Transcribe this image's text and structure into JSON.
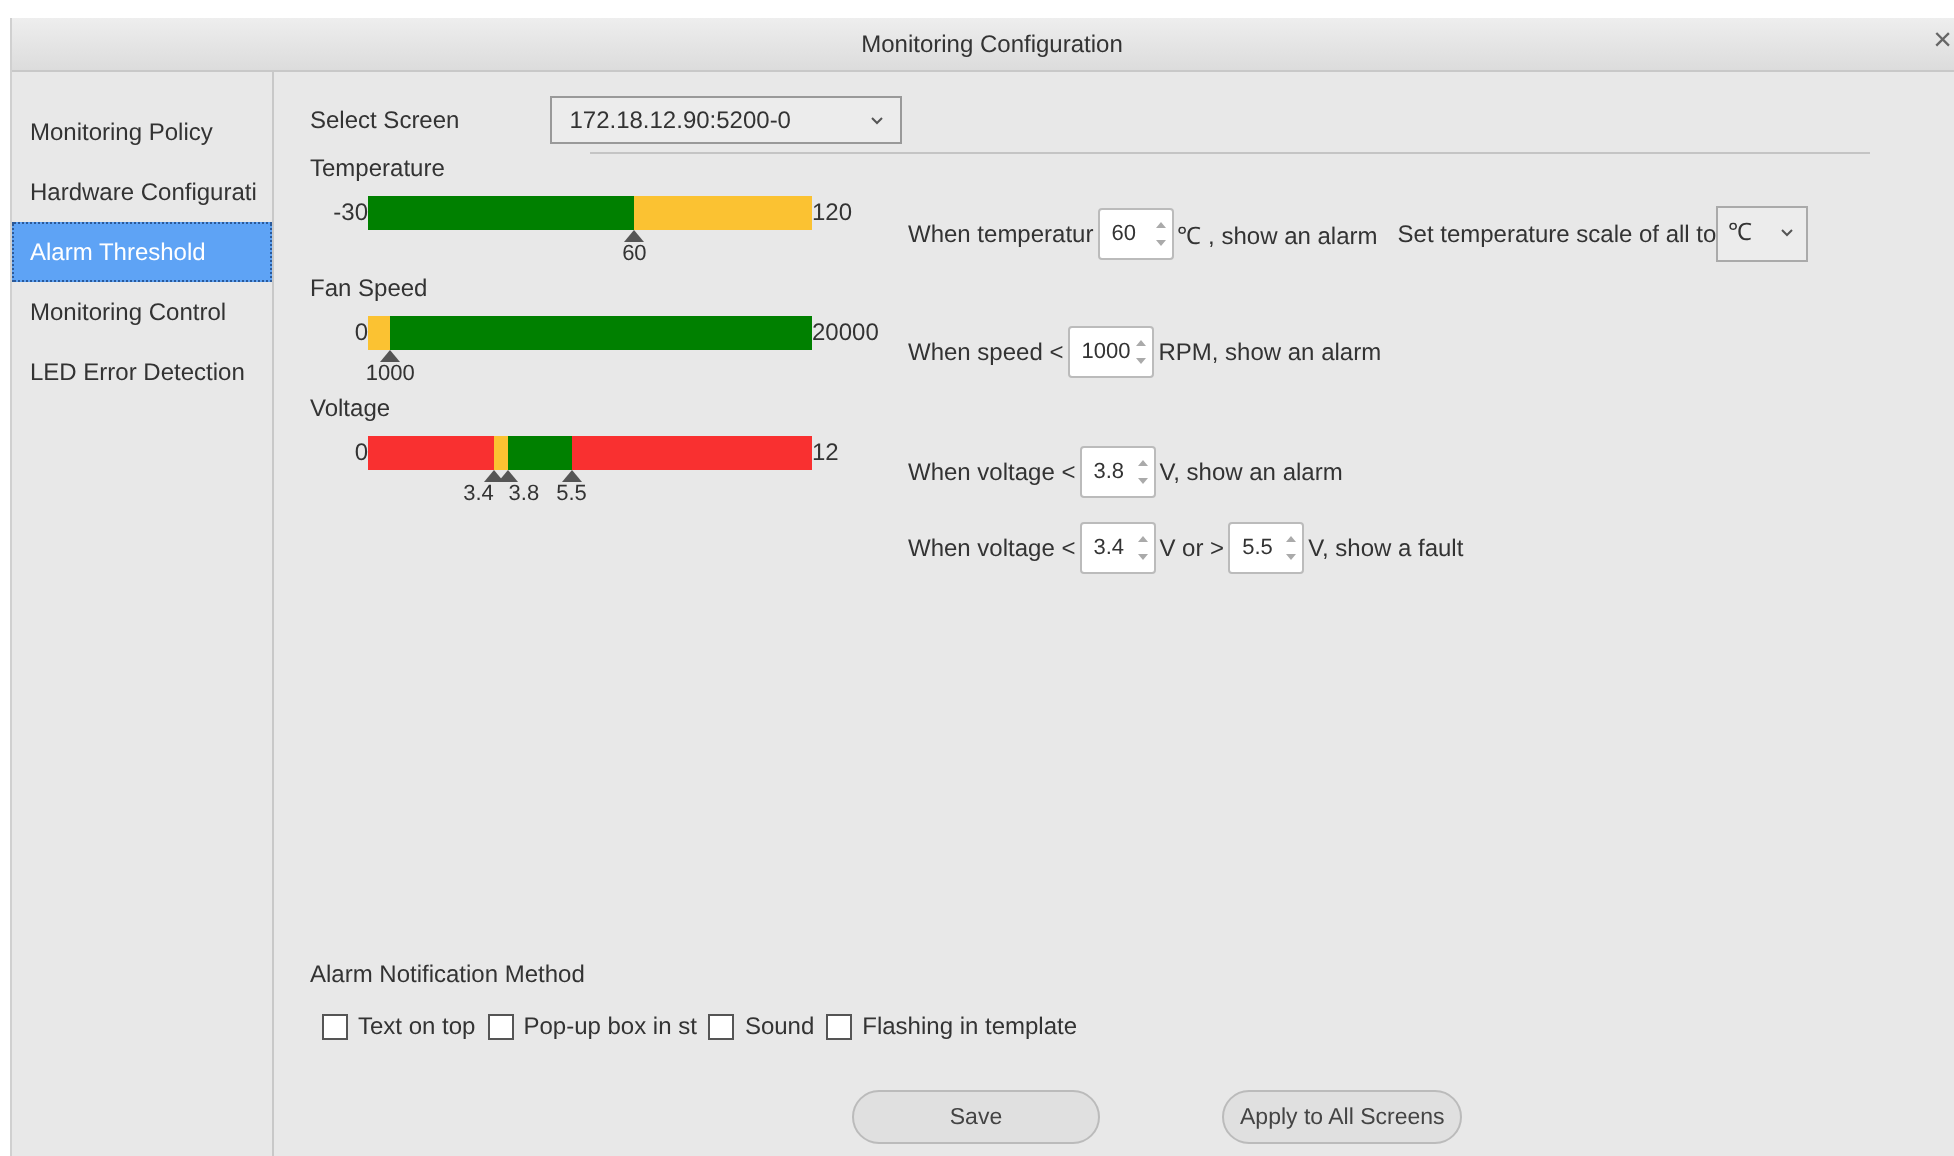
{
  "window": {
    "title": "Monitoring Configuration",
    "close": "×"
  },
  "sidebar": {
    "items": [
      {
        "label": "Monitoring Policy",
        "selected": false
      },
      {
        "label": "Hardware Configurati",
        "selected": false
      },
      {
        "label": "Alarm Threshold",
        "selected": true
      },
      {
        "label": "Monitoring Control",
        "selected": false
      },
      {
        "label": "LED Error Detection",
        "selected": false
      }
    ]
  },
  "select_screen": {
    "label": "Select Screen",
    "value": "172.18.12.90:5200-0"
  },
  "sensors": [
    {
      "name": "Temperature",
      "min": "-30",
      "max": "120",
      "segments": [
        {
          "color": "#008000"
        },
        {
          "color": "#fbc232"
        }
      ],
      "markers": [
        "60"
      ],
      "rules": [
        [
          {
            "kind": "text",
            "text": "When temperatur"
          },
          {
            "kind": "spin",
            "value": "60"
          },
          {
            "kind": "text",
            "text": "℃ , show an alarm"
          },
          {
            "kind": "gap"
          },
          {
            "kind": "text",
            "text": "Set temperature scale of all to"
          },
          {
            "kind": "select",
            "value": "℃"
          }
        ]
      ]
    },
    {
      "name": "Fan Speed",
      "min": "0",
      "max": "20000",
      "segments": [
        {
          "color": "#fbc232"
        },
        {
          "color": "#008000"
        }
      ],
      "markers": [
        "1000"
      ],
      "rules": [
        [
          {
            "kind": "text",
            "text": "When speed <"
          },
          {
            "kind": "spin",
            "value": "1000"
          },
          {
            "kind": "text",
            "text": "RPM, show an alarm"
          }
        ]
      ]
    },
    {
      "name": "Voltage",
      "min": "0",
      "max": "12",
      "segments": [
        {
          "color": "#f93030"
        },
        {
          "color": "#fbc232"
        },
        {
          "color": "#008000"
        },
        {
          "color": "#f93030"
        }
      ],
      "markers": [
        "3.4",
        "3.8",
        "5.5"
      ],
      "rules": [
        [
          {
            "kind": "text",
            "text": "When voltage <"
          },
          {
            "kind": "spin",
            "value": "3.8"
          },
          {
            "kind": "text",
            "text": "V, show an alarm"
          }
        ],
        [
          {
            "kind": "text",
            "text": "When voltage <"
          },
          {
            "kind": "spin",
            "value": "3.4"
          },
          {
            "kind": "text",
            "text": "V or >"
          },
          {
            "kind": "spin",
            "value": "5.5"
          },
          {
            "kind": "text",
            "text": "V, show a fault"
          }
        ]
      ]
    }
  ],
  "notification": {
    "title": "Alarm Notification Method",
    "options": [
      {
        "label": "Text on top",
        "checked": false
      },
      {
        "label": "Pop-up box in st",
        "checked": false
      },
      {
        "label": "Sound",
        "checked": false
      },
      {
        "label": "Flashing in template",
        "checked": false
      }
    ]
  },
  "buttons": [
    "Save",
    "Apply to All Screens"
  ]
}
